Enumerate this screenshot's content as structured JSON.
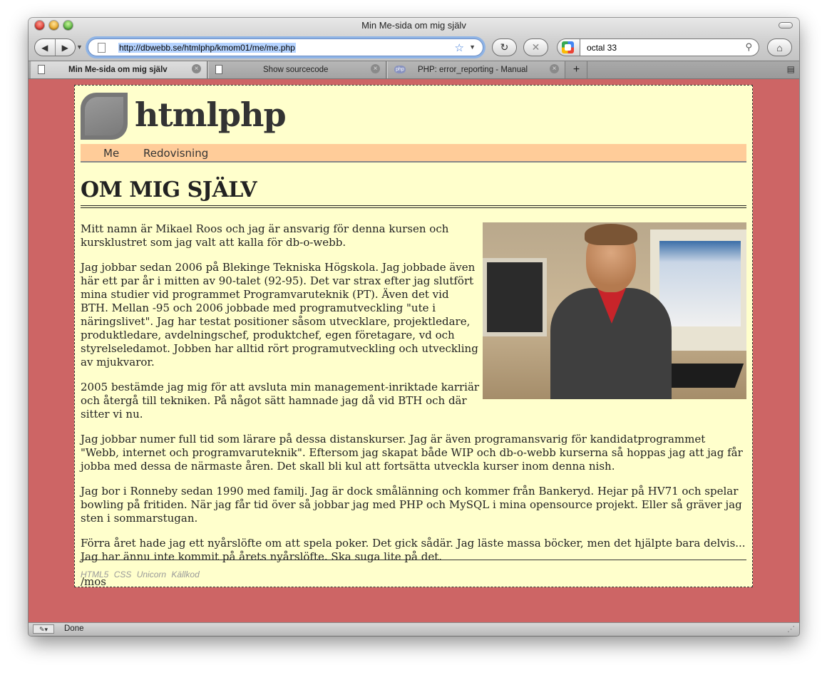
{
  "window": {
    "title": "Min Me-sida om mig själv"
  },
  "toolbar": {
    "back_icon": "back-arrow-icon",
    "forward_icon": "forward-arrow-icon",
    "url": "http://dbwebb.se/htmlphp/kmom01/me/me.php",
    "reload_icon": "reload-icon",
    "stop_icon": "stop-icon",
    "search_query": "octal 33",
    "home_icon": "home-icon"
  },
  "tabs": [
    {
      "label": "Min Me-sida om mig själv",
      "active": true
    },
    {
      "label": "Show sourcecode",
      "active": false
    },
    {
      "label": "PHP: error_reporting - Manual",
      "active": false
    }
  ],
  "tab_php_favicon": "php",
  "site": {
    "title": "htmlphp",
    "nav": [
      "Me",
      "Redovisning"
    ],
    "heading": "OM MIG SJÄLV",
    "paragraphs": [
      "Mitt namn är Mikael Roos och jag är ansvarig för denna kursen och kursklustret som jag valt att kalla för db-o-webb.",
      "Jag jobbar sedan 2006 på Blekinge Tekniska Högskola. Jag jobbade även här ett par år i mitten av 90-talet (92-95). Det var strax efter jag slutfört mina studier vid programmet Programvaruteknik (PT). Även det vid BTH. Mellan -95 och 2006 jobbade med programutveckling \"ute i näringslivet\". Jag har testat positioner såsom utvecklare, projektledare, produktledare, avdelningschef, produktchef, egen företagare, vd och styrelseledamot. Jobben har alltid rört programutveckling och utveckling av mjukvaror.",
      "2005 bestämde jag mig för att avsluta min management-inriktade karriär och återgå till tekniken. På något sätt hamnade jag då vid BTH och där sitter vi nu.",
      "Jag jobbar numer full tid som lärare på dessa distanskurser. Jag är även programansvarig för kandidatprogrammet \"Webb, internet och programvaruteknik\". Eftersom jag skapat både WIP och db-o-webb kurserna så hoppas jag att jag får jobba med dessa de närmaste åren. Det skall bli kul att fortsätta utveckla kurser inom denna nish.",
      "Jag bor i Ronneby sedan 1990 med familj. Jag är dock smålänning och kommer från Bankeryd. Hejar på HV71 och spelar bowling på fritiden. När jag får tid över så jobbar jag med PHP och MySQL i mina opensource projekt. Eller så gräver jag sten i sommarstugan.",
      "Förra året hade jag ett nyårslöfte om att spela poker. Det gick sådär. Jag läste massa böcker, men det hjälpte bara delvis... Jag har ännu inte kommit på årets nyårslöfte. Ska suga lite på det.",
      "/mos"
    ],
    "footer_links": [
      "HTML5",
      "CSS",
      "Unicorn",
      "Källkod"
    ]
  },
  "status": {
    "text": "Done"
  },
  "colors": {
    "page_bg": "#cd6565",
    "content_bg": "#ffffcc",
    "navbar_bg": "#ffcc99"
  }
}
